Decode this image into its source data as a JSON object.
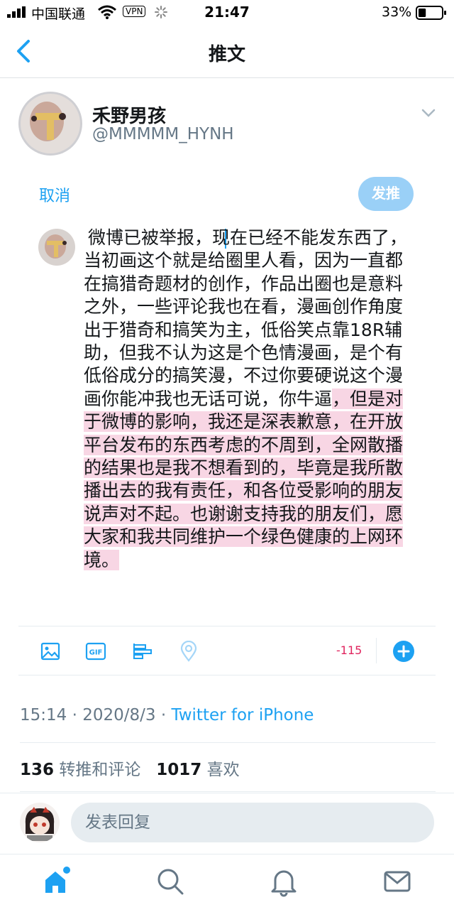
{
  "status_bar": {
    "carrier": "中国联通",
    "vpn": "VPN",
    "time": "21:47",
    "battery": "33%",
    "battery_level": 0.33
  },
  "nav": {
    "title": "推文",
    "back_icon": "chevron-left-icon"
  },
  "author": {
    "name": "禾野男孩",
    "handle": "@MMMMM_HYNH"
  },
  "compose": {
    "cancel_label": "取消",
    "post_label": "发推",
    "text_normal": "微博已被举报，现在已经不能发东西了，当初画这个就是给圈里人看，因为一直都在搞猎奇题材的创作，作品出圈也是意料之外，一些评论我也在看，漫画创作角度出于猎奇和搞笑为主，低俗笑点靠18R辅助，但我不认为这是个色情漫画，是个有低俗成分的搞笑漫，不过你要硬说这个漫画你能冲我也无话可说，你牛逼",
    "text_highlighted": "，但是对于微博的影响，我还是深表歉意，在开放平台发布的东西考虑的不周到，全网散播的结果也是我不想看到的，毕竟是我所散播出去的我有责任，和各位受影响的朋友说声对不起。也谢谢支持我的朋友们，愿大家和我共同维护一个绿色健康的上网环境。",
    "highlight_color": "#f8d6e4"
  },
  "toolbar": {
    "icons": [
      "image-icon",
      "gif-icon",
      "poll-icon",
      "location-icon",
      "add-icon"
    ],
    "gif_label": "GIF",
    "char_counter": "-115"
  },
  "meta": {
    "time": "15:14",
    "date": "2020/8/3",
    "separator": "·",
    "source": "Twitter for iPhone"
  },
  "stats": {
    "retweets_count": "136",
    "retweets_label": "转推和评论",
    "likes_count": "1017",
    "likes_label": "喜欢"
  },
  "reply": {
    "placeholder": "发表回复"
  },
  "tabs": [
    "home-icon",
    "search-icon",
    "notifications-icon",
    "messages-icon"
  ],
  "colors": {
    "accent": "#1da1f2",
    "post_button_disabled": "#9ad0f7",
    "counter_negative": "#e0245e",
    "secondary_text": "#657786"
  }
}
